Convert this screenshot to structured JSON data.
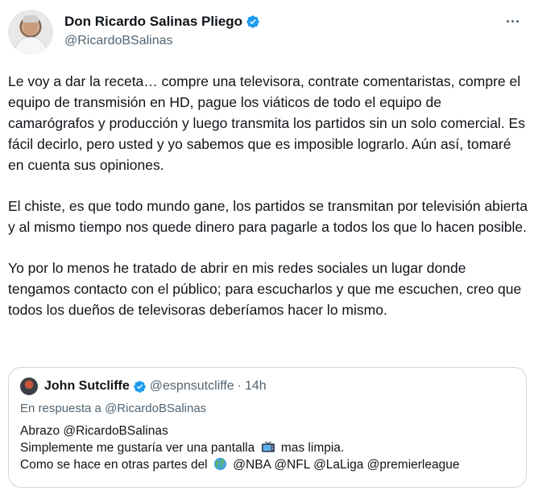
{
  "author": {
    "display_name": "Don Ricardo Salinas Pliego",
    "handle": "@RicardoBSalinas"
  },
  "tweet": {
    "paragraphs": [
      "Le voy a dar la receta… compre una televisora, contrate comentaristas, compre el equipo de transmisión en HD, pague los viáticos de todo el equipo de camarógrafos y producción y luego transmita los partidos sin un solo comercial. Es fácil decirlo, pero usted y yo sabemos que es imposible lograrlo. Aún así, tomaré en cuenta sus opiniones.",
      "El chiste, es que todo mundo gane, los partidos se transmitan por televisión abierta y al mismo tiempo nos quede dinero para pagarle a todos los que lo hacen posible.",
      "Yo por lo menos he tratado de abrir en mis redes sociales un lugar donde tengamos contacto con el público; para escucharlos y que me escuchen, creo que todos los dueños de televisoras deberíamos hacer lo mismo."
    ]
  },
  "quoted": {
    "display_name": "John Sutcliffe",
    "handle": "@espnsutcliffe",
    "separator": "·",
    "time": "14h",
    "reply_to": "En respuesta a @RicardoBSalinas",
    "line1": "Abrazo @RicardoBSalinas",
    "line2_before": "Simplemente me gustaría ver una pantalla",
    "line2_after": "mas limpia.",
    "line3_before": "Como se hace en otras partes del",
    "line3_after": "@NBA @NFL @LaLiga @premierleague"
  },
  "icons": {
    "verified": "verified-badge-icon",
    "more": "more-options-icon",
    "tv": "television-emoji-icon",
    "globe": "globe-emoji-icon"
  },
  "colors": {
    "verified_blue": "#1d9bf0",
    "secondary_text": "#536471",
    "border": "#cfd9de"
  }
}
